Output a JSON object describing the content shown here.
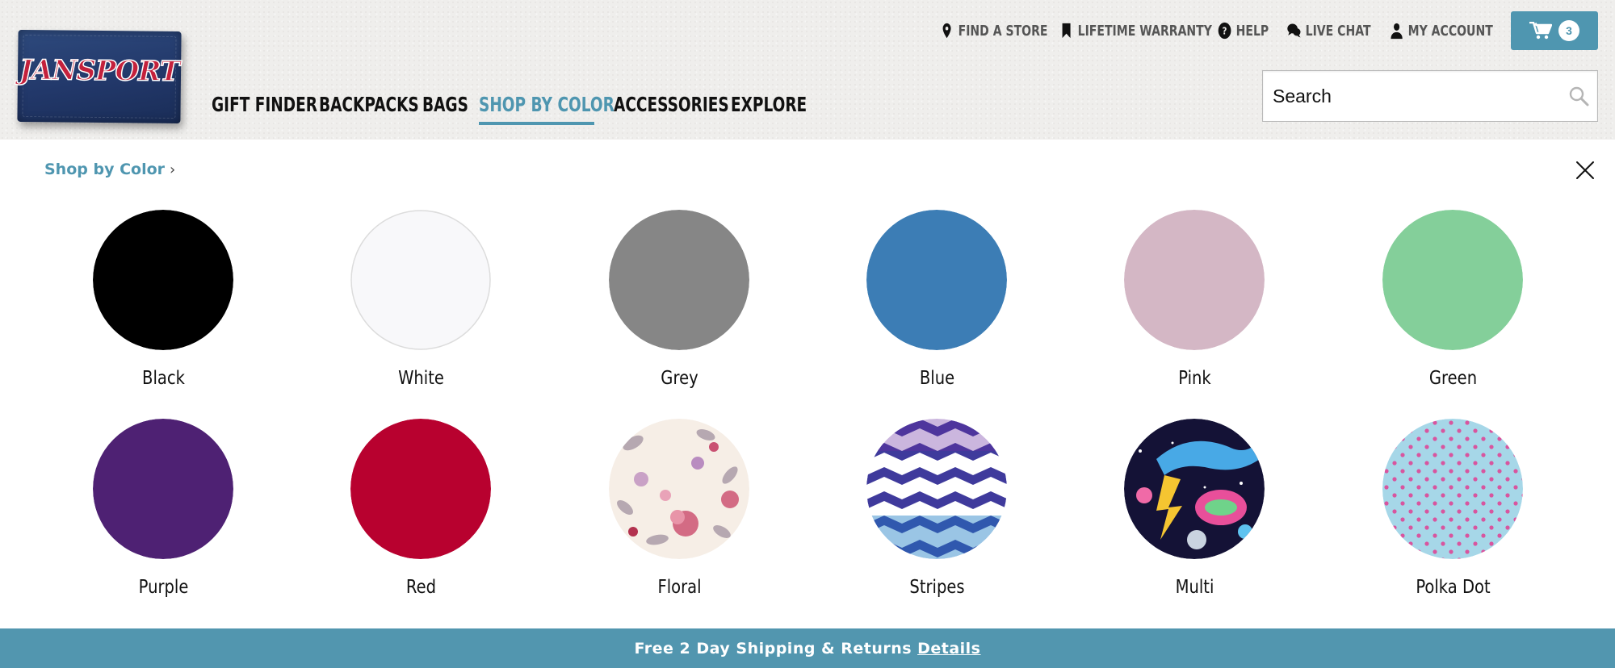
{
  "brand": {
    "name": "JANSPORT",
    "logo_colors": {
      "background": "#22386a",
      "text": "#c4213c"
    }
  },
  "utility_nav": [
    {
      "label": "FIND A STORE",
      "icon": "map-pin-icon"
    },
    {
      "label": "LIFETIME WARRANTY",
      "icon": "bookmark-icon"
    },
    {
      "label": "HELP",
      "icon": "help-circle-icon"
    },
    {
      "label": "LIVE CHAT",
      "icon": "chat-bubbles-icon"
    },
    {
      "label": "MY ACCOUNT",
      "icon": "user-icon"
    }
  ],
  "cart": {
    "icon": "cart-icon",
    "count": "3"
  },
  "main_nav": [
    {
      "label": "GIFT FINDER"
    },
    {
      "label": "BACKPACKS"
    },
    {
      "label": "BAGS"
    },
    {
      "label": "SHOP BY COLOR",
      "active": true
    },
    {
      "label": "ACCESSORIES"
    },
    {
      "label": "EXPLORE"
    }
  ],
  "search": {
    "placeholder": "Search",
    "value": ""
  },
  "panel": {
    "breadcrumb": "Shop by Color",
    "colors": [
      {
        "name": "Black",
        "swatch": "#000000"
      },
      {
        "name": "White",
        "swatch": "#f8f8fa"
      },
      {
        "name": "Grey",
        "swatch": "#868686"
      },
      {
        "name": "Blue",
        "swatch": "#3c7db5"
      },
      {
        "name": "Pink",
        "swatch": "#d4b7c5"
      },
      {
        "name": "Green",
        "swatch": "#84cf9a"
      },
      {
        "name": "Purple",
        "swatch": "#4e2173"
      },
      {
        "name": "Red",
        "swatch": "#b8012f"
      },
      {
        "name": "Floral",
        "swatch": "floral-pattern"
      },
      {
        "name": "Stripes",
        "swatch": "chevron-pattern"
      },
      {
        "name": "Multi",
        "swatch": "multi-pattern"
      },
      {
        "name": "Polka Dot",
        "swatch": "polka-dot-pattern"
      }
    ]
  },
  "promo_bar": {
    "text": "Free 2 Day Shipping & Returns",
    "link": "Details"
  },
  "theme": {
    "accent": "#4f96b0",
    "bar": "#5296af"
  }
}
